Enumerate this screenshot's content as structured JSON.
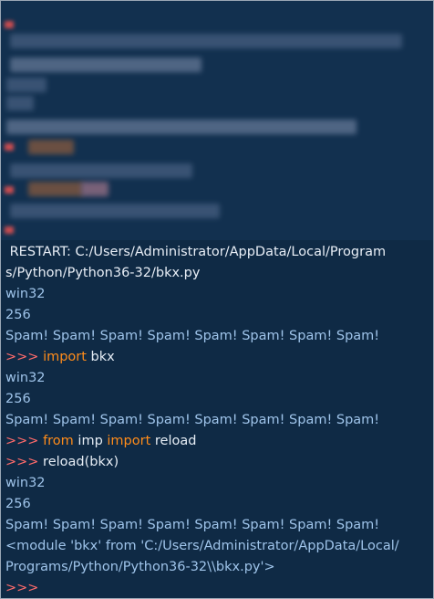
{
  "shell": {
    "restart_line": " RESTART: C:/Users/Administrator/AppData/Local/Program",
    "restart_line_2": "s/Python/Python36-32/bkx.py",
    "run1": {
      "platform": "win32",
      "number": "256",
      "spam": "Spam! Spam! Spam! Spam! Spam! Spam! Spam! Spam!"
    },
    "prompt": ">>>",
    "cmd_import": {
      "keyword": "import",
      "module": " bkx"
    },
    "run2": {
      "platform": "win32",
      "number": "256",
      "spam": "Spam! Spam! Spam! Spam! Spam! Spam! Spam! Spam!"
    },
    "cmd_from": {
      "kw_from": "from",
      "module": " imp ",
      "kw_import": "import",
      "name": " reload"
    },
    "cmd_reload": " reload(bkx)",
    "run3": {
      "platform": "win32",
      "number": "256",
      "spam": "Spam! Spam! Spam! Spam! Spam! Spam! Spam! Spam!"
    },
    "module_repr_1": "<module 'bkx' from 'C:/Users/Administrator/AppData/Local/",
    "module_repr_2": "Programs/Python/Python36-32\\\\bkx.py'>"
  },
  "colors": {
    "background": "#0f2a45",
    "prompt": "#ff6b6b",
    "keyword": "#ff8c1a",
    "output": "#9fc4ea"
  }
}
